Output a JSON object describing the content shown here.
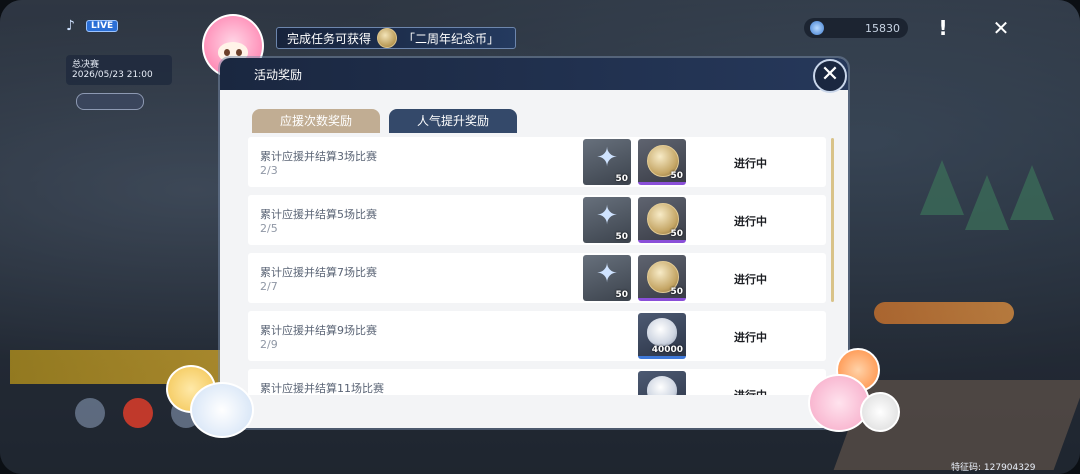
{
  "hud": {
    "live_tag": "LIVE",
    "match_name": "总决赛",
    "match_date": "2026/05/23 21:00",
    "currency_value": "15830",
    "fan_id": "特征码: 127904329"
  },
  "banner": {
    "text": "完成任务可获得",
    "reward": "「二周年纪念币」"
  },
  "modal": {
    "title": "活动奖励",
    "tabs": [
      {
        "label": "应援次数奖励",
        "active": true
      },
      {
        "label": "人气提升奖励",
        "active": false
      }
    ],
    "rows": [
      {
        "title": "累计应援并结算3场比赛",
        "progress": "2/3",
        "status": "进行中",
        "rewards": [
          {
            "icon": "star-crystal-icon",
            "qty": "50"
          },
          {
            "icon": "anniversary-coin-icon",
            "qty": "50"
          }
        ]
      },
      {
        "title": "累计应援并结算5场比赛",
        "progress": "2/5",
        "status": "进行中",
        "rewards": [
          {
            "icon": "star-crystal-icon",
            "qty": "50"
          },
          {
            "icon": "anniversary-coin-icon",
            "qty": "50"
          }
        ]
      },
      {
        "title": "累计应援并结算7场比赛",
        "progress": "2/7",
        "status": "进行中",
        "rewards": [
          {
            "icon": "star-crystal-icon",
            "qty": "50"
          },
          {
            "icon": "anniversary-coin-icon",
            "qty": "50"
          }
        ]
      },
      {
        "title": "累计应援并结算9场比赛",
        "progress": "2/9",
        "status": "进行中",
        "rewards": [
          {
            "icon": "shell-icon",
            "qty": "40000"
          }
        ]
      },
      {
        "title": "累计应援并结算11场比赛",
        "progress": "",
        "status": "进行中",
        "rewards": [
          {
            "icon": "shell-icon",
            "qty": ""
          }
        ]
      }
    ]
  },
  "colors": {
    "header": "#1a2740",
    "tab_active": "#c1ad93",
    "tab_inactive": "#34496a",
    "coin_rarity": "#8a4fd8",
    "shell_rarity": "#3e78d8"
  }
}
